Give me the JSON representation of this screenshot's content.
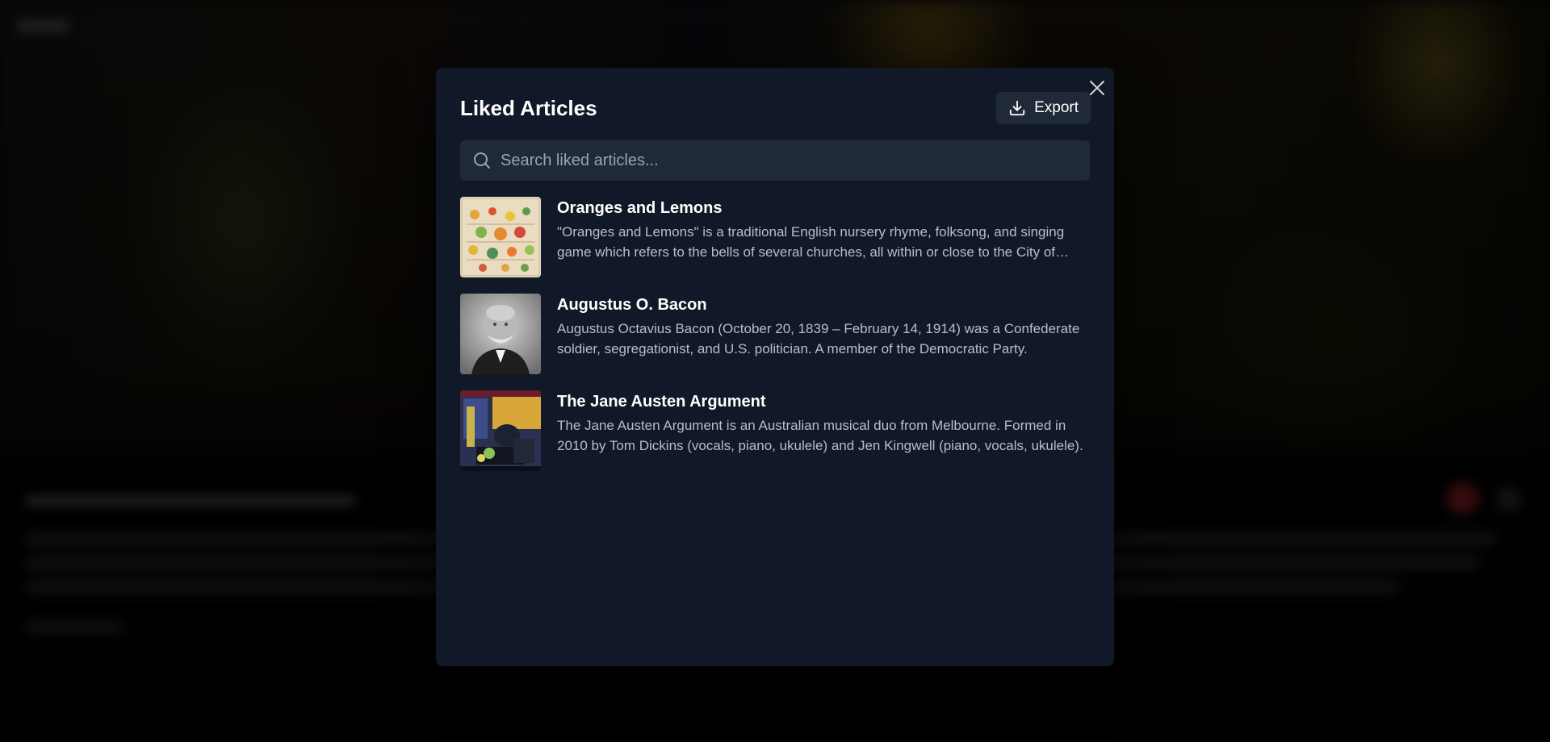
{
  "modal": {
    "title": "Liked Articles",
    "export_label": "Export",
    "search_placeholder": "Search liked articles..."
  },
  "articles": [
    {
      "title": "Oranges and Lemons",
      "description": "\"Oranges and Lemons\" is a traditional English nursery rhyme, folksong, and singing game which refers to the bells of several churches, all within or close to the City of London."
    },
    {
      "title": "Augustus O. Bacon",
      "description": "Augustus Octavius Bacon (October 20, 1839 – February 14, 1914) was a Confederate soldier, segregationist, and U.S. politician. A member of the Democratic Party."
    },
    {
      "title": "The Jane Austen Argument",
      "description": "The Jane Austen Argument is an Australian musical duo from Melbourne. Formed in 2010 by Tom Dickins (vocals, piano, ukulele) and Jen Kingwell (piano, vocals, ukulele)."
    }
  ],
  "icons": {
    "export": "download-icon",
    "close": "close-icon",
    "search": "search-icon"
  },
  "colors": {
    "modal_bg": "#111827",
    "control_bg": "#1f2937",
    "title_text": "#ffffff",
    "desc_text": "#b8bec8",
    "placeholder_text": "#9ca3af"
  }
}
